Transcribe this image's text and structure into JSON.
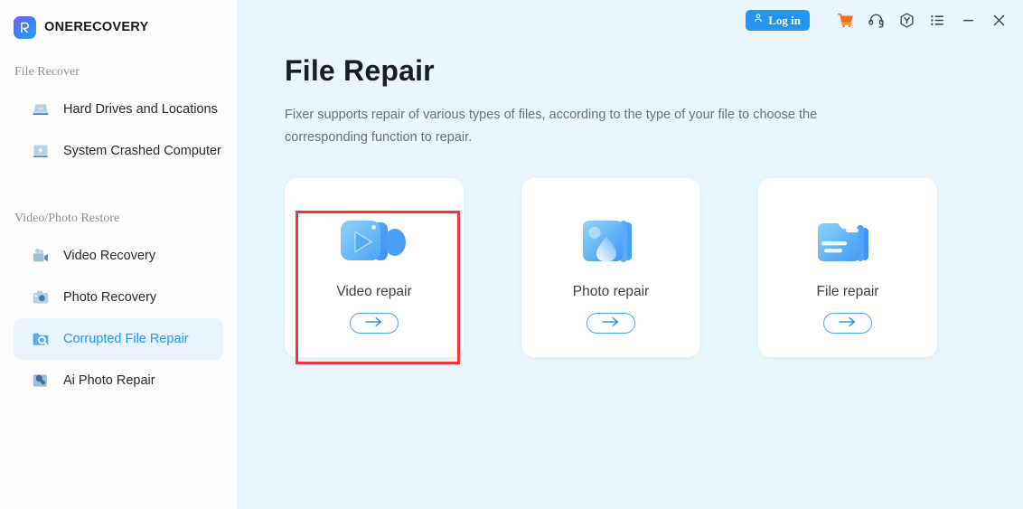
{
  "app": {
    "brand_name": "ONERECOVERY",
    "logo_icon": "onerecovery-logo-icon"
  },
  "sidebar": {
    "groups": [
      {
        "label": "File Recover",
        "items": [
          {
            "label": "Hard Drives and Locations",
            "icon": "hard-drive-icon",
            "active": false
          },
          {
            "label": "System Crashed Computer",
            "icon": "crashed-computer-icon",
            "active": false
          }
        ]
      },
      {
        "label": "Video/Photo Restore",
        "items": [
          {
            "label": "Video Recovery",
            "icon": "video-camera-icon",
            "active": false
          },
          {
            "label": "Photo Recovery",
            "icon": "camera-icon",
            "active": false
          },
          {
            "label": "Corrupted File Repair",
            "icon": "file-repair-icon",
            "active": true
          },
          {
            "label": "Ai Photo Repair",
            "icon": "ai-photo-repair-icon",
            "active": false
          }
        ]
      }
    ]
  },
  "topbar": {
    "login_label": "Log in",
    "login_icon": "user-icon",
    "icons": [
      {
        "name": "cart-icon",
        "color": "#fb6a16"
      },
      {
        "name": "headset-support-icon",
        "color": "#3b4a58"
      },
      {
        "name": "shield-badge-icon",
        "color": "#3b4a58"
      },
      {
        "name": "list-menu-icon",
        "color": "#3b4a58"
      },
      {
        "name": "minimize-icon",
        "color": "#3b4a58"
      },
      {
        "name": "close-icon",
        "color": "#3b4a58"
      }
    ]
  },
  "main": {
    "title": "File Repair",
    "description": "Fixer supports repair of various types of files, according to the type of your file to choose the corresponding function to repair.",
    "cards": [
      {
        "label": "Video repair",
        "icon": "video-repair-icon",
        "arrow": "arrow-right-icon",
        "highlighted": true
      },
      {
        "label": "Photo repair",
        "icon": "photo-repair-icon",
        "arrow": "arrow-right-icon",
        "highlighted": false
      },
      {
        "label": "File repair",
        "icon": "file-repair-folder-icon",
        "arrow": "arrow-right-icon",
        "highlighted": false
      }
    ]
  },
  "colors": {
    "accent": "#2196f3",
    "main_bg": "#e9f6fd",
    "sidebar_bg": "#fdfdfe",
    "highlight_border": "#f5333f",
    "cart_orange": "#fb6a16"
  }
}
